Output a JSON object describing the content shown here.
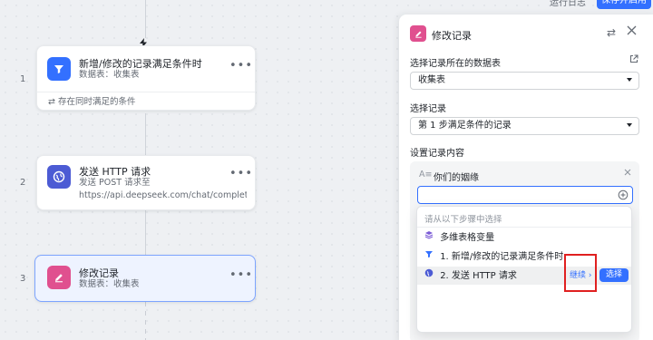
{
  "topbar": {
    "run_log": "运行日志",
    "save_label": "保存并启用"
  },
  "steps": [
    {
      "number": "1",
      "title": "新增/修改的记录满足条件时",
      "sub": "数据表：收集表",
      "condition": "存在同时满足的条件",
      "icon": "filter-icon",
      "color": "#3370ff"
    },
    {
      "number": "2",
      "title": "发送 HTTP 请求",
      "sub1": "发送 POST 请求至",
      "sub2": "https://api.deepseek.com/chat/completi...",
      "icon": "globe-icon",
      "color": "#4c5bd4"
    },
    {
      "number": "3",
      "title": "修改记录",
      "sub": "数据表：收集表",
      "icon": "edit-icon",
      "color": "#e0508f"
    }
  ],
  "panel": {
    "title": "修改记录",
    "table_label": "选择记录所在的数据表",
    "table_value": "收集表",
    "record_label": "选择记录",
    "record_value": "第 1 步满足条件的记录",
    "content_label": "设置记录内容",
    "field_name": "你们的姻缘",
    "field_value": "",
    "dropdown": {
      "header": "请从以下步骤中选择",
      "items": [
        {
          "label": "多维表格变量",
          "icon": "layers-icon"
        },
        {
          "label": "1. 新增/修改的记录满足条件时",
          "icon": "filter-icon"
        },
        {
          "label": "2. 发送 HTTP 请求",
          "icon": "globe-icon",
          "continue": "继续",
          "choose": "选择"
        }
      ]
    }
  },
  "colors": {
    "accent": "#3370ff",
    "edit": "#e0508f",
    "highlight_box": "#e02020"
  }
}
